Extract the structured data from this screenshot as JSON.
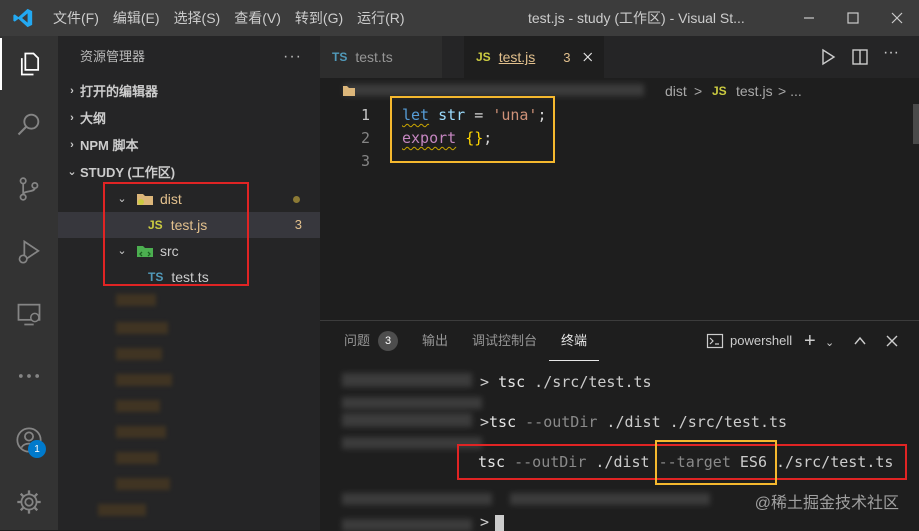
{
  "titlebar": {
    "menu": [
      "文件(F)",
      "编辑(E)",
      "选择(S)",
      "查看(V)",
      "转到(G)",
      "运行(R)"
    ],
    "title": "test.js - study (工作区) - Visual St..."
  },
  "activitybar": {
    "accounts_badge": "1"
  },
  "sidebar": {
    "header": "资源管理器",
    "more": "···",
    "sections": {
      "open_editors": "打开的编辑器",
      "outline": "大纲",
      "npm_scripts": "NPM 脚本",
      "workspace": "STUDY (工作区)"
    },
    "tree": {
      "dist": "dist",
      "dist_file": "test.js",
      "dist_file_problems": "3",
      "src": "src",
      "src_file": "test.ts"
    },
    "icons": {
      "js": "JS",
      "ts": "TS"
    }
  },
  "editor": {
    "tabs": [
      {
        "icon": "TS",
        "label": "test.ts",
        "badge": ""
      },
      {
        "icon": "JS",
        "label": "test.js",
        "badge": "3"
      }
    ],
    "breadcrumb": {
      "folder": "dist",
      "sep": ">",
      "icon": "JS",
      "file": "test.js",
      "tail": "> ..."
    },
    "line_numbers": [
      "1",
      "2",
      "3"
    ],
    "code": {
      "l1_kw": "let",
      "l1_var": "str",
      "l1_eq": " = ",
      "l1_str": "'una'",
      "l1_end": ";",
      "l2_kw": "export",
      "l2_brace": "{}",
      "l2_end": ";"
    }
  },
  "panel": {
    "tabs": {
      "problems": "问题",
      "problems_count": "3",
      "output": "输出",
      "debug": "调试控制台",
      "terminal": "终端"
    },
    "shell": "powershell",
    "terminal": {
      "line1_prompt": "> ",
      "line1_cmd": "tsc",
      "line1_args": " ./src/test.ts",
      "line2_prompt": ">",
      "line2_cmd": "tsc",
      "line2_flag": " --outDir",
      "line2_args": " ./dist ./src/test.ts",
      "line3_cmd": "tsc",
      "line3_flag": " --outDir",
      "line3_args": " ./dist ",
      "line3_flag2": "--target",
      "line3_val": " ES6",
      "line3_tail": " ./src/test.ts",
      "line4_prompt": ">"
    }
  },
  "watermark": "@稀土掘金技术社区",
  "colors": {
    "accent": "#007acc",
    "red_box": "#e02424",
    "yellow_box": "#f5b82e"
  }
}
